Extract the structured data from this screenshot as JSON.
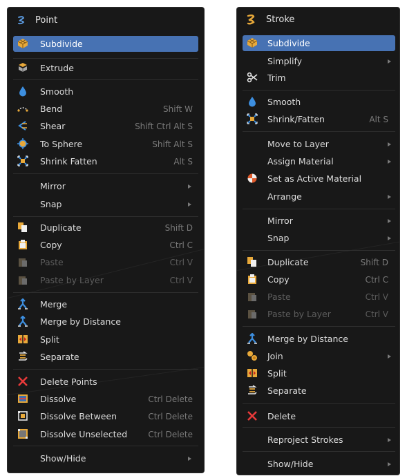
{
  "left_menu": {
    "title": "Point",
    "items": [
      {
        "label": "Subdivide",
        "icon": "subdivide-icon",
        "highlighted": true
      },
      {
        "label": "Extrude",
        "icon": "extrude-icon"
      },
      {
        "label": "Smooth",
        "icon": "smooth-drop-icon"
      },
      {
        "label": "Bend",
        "icon": "bend-icon",
        "shortcut": "Shift W"
      },
      {
        "label": "Shear",
        "icon": "shear-icon",
        "shortcut": "Shift Ctrl Alt S"
      },
      {
        "label": "To Sphere",
        "icon": "to-sphere-icon",
        "shortcut": "Shift Alt S"
      },
      {
        "label": "Shrink Fatten",
        "icon": "shrink-fatten-icon",
        "shortcut": "Alt S"
      },
      {
        "label": "Mirror",
        "submenu": true
      },
      {
        "label": "Snap",
        "submenu": true
      },
      {
        "label": "Duplicate",
        "icon": "duplicate-icon",
        "shortcut": "Shift D"
      },
      {
        "label": "Copy",
        "icon": "copy-icon",
        "shortcut": "Ctrl C"
      },
      {
        "label": "Paste",
        "icon": "paste-icon",
        "shortcut": "Ctrl V",
        "disabled": true
      },
      {
        "label": "Paste by Layer",
        "icon": "paste-by-layer-icon",
        "shortcut": "Ctrl V",
        "disabled": true
      },
      {
        "label": "Merge",
        "icon": "merge-icon"
      },
      {
        "label": "Merge by Distance",
        "icon": "merge-by-distance-icon"
      },
      {
        "label": "Split",
        "icon": "split-icon"
      },
      {
        "label": "Separate",
        "icon": "separate-icon"
      },
      {
        "label": "Delete Points",
        "icon": "delete-x-icon"
      },
      {
        "label": "Dissolve",
        "icon": "dissolve-icon",
        "shortcut": "Ctrl Delete"
      },
      {
        "label": "Dissolve Between",
        "icon": "dissolve-between-icon",
        "shortcut": "Ctrl Delete"
      },
      {
        "label": "Dissolve Unselected",
        "icon": "dissolve-unselected-icon",
        "shortcut": "Ctrl Delete"
      },
      {
        "label": "Show/Hide",
        "submenu": true
      }
    ]
  },
  "right_menu": {
    "title": "Stroke",
    "items": [
      {
        "label": "Subdivide",
        "icon": "subdivide-icon",
        "highlighted": true
      },
      {
        "label": "Simplify",
        "submenu": true
      },
      {
        "label": "Trim",
        "icon": "scissors-icon"
      },
      {
        "label": "Smooth",
        "icon": "smooth-drop-icon"
      },
      {
        "label": "Shrink/Fatten",
        "icon": "shrink-fatten-icon",
        "shortcut": "Alt S"
      },
      {
        "label": "Move to Layer",
        "submenu": true
      },
      {
        "label": "Assign Material",
        "submenu": true
      },
      {
        "label": "Set as Active Material",
        "icon": "material-ball-icon"
      },
      {
        "label": "Arrange",
        "submenu": true
      },
      {
        "label": "Mirror",
        "submenu": true
      },
      {
        "label": "Snap",
        "submenu": true
      },
      {
        "label": "Duplicate",
        "icon": "duplicate-icon",
        "shortcut": "Shift D"
      },
      {
        "label": "Copy",
        "icon": "copy-icon",
        "shortcut": "Ctrl C"
      },
      {
        "label": "Paste",
        "icon": "paste-icon",
        "shortcut": "Ctrl V",
        "disabled": true
      },
      {
        "label": "Paste by Layer",
        "icon": "paste-by-layer-icon",
        "shortcut": "Ctrl V",
        "disabled": true
      },
      {
        "label": "Merge by Distance",
        "icon": "merge-by-distance-icon"
      },
      {
        "label": "Join",
        "icon": "join-icon",
        "submenu": true
      },
      {
        "label": "Split",
        "icon": "split-icon"
      },
      {
        "label": "Separate",
        "icon": "separate-icon"
      },
      {
        "label": "Delete",
        "icon": "delete-x-icon"
      },
      {
        "label": "Reproject Strokes",
        "submenu": true
      },
      {
        "label": "Show/Hide",
        "submenu": true
      }
    ]
  },
  "colors": {
    "menu_background": "#181818",
    "highlight": "#4772b3",
    "text": "#dcdcdc",
    "shortcut_text": "#7a7a7a",
    "disabled_text": "#5d5d5d",
    "separator": "#2e2e2e"
  }
}
